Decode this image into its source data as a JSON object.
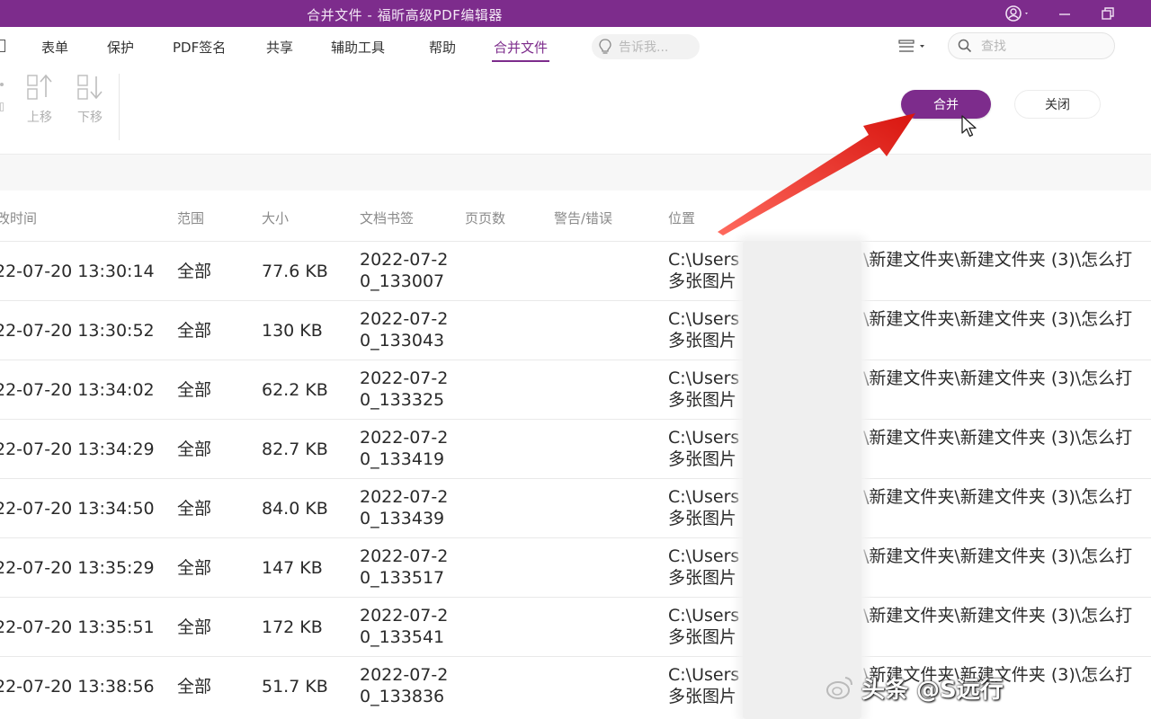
{
  "window": {
    "title": "合并文件 - 福昕高级PDF编辑器"
  },
  "menu": {
    "items": [
      "表单",
      "保护",
      "PDF签名",
      "共享",
      "辅助工具",
      "帮助",
      "合并文件"
    ],
    "active_index": 6,
    "tell_me_placeholder": "告诉我...",
    "search_placeholder": "查找"
  },
  "ribbon": {
    "move_up_label": "上移",
    "move_down_label": "下移",
    "merge_label": "合并",
    "close_label": "关闭"
  },
  "table": {
    "headers": {
      "modified": "改时间",
      "range": "范围",
      "size": "大小",
      "bookmark": "文档书签",
      "pages": "页页数",
      "warnings": "警告/错误",
      "location": "位置"
    },
    "rows": [
      {
        "time": "22-07-20 13:30:14",
        "range": "全部",
        "size": "77.6 KB",
        "bm1": "2022-07-2",
        "bm2": "0_133007",
        "loc1": "C:\\Users",
        "loc2": "多张图片",
        "path": "\\新建文件夹\\新建文件夹 (3)\\怎么打"
      },
      {
        "time": "22-07-20 13:30:52",
        "range": "全部",
        "size": "130 KB",
        "bm1": "2022-07-2",
        "bm2": "0_133043",
        "loc1": "C:\\Users",
        "loc2": "多张图片",
        "path": "\\新建文件夹\\新建文件夹 (3)\\怎么打"
      },
      {
        "time": "22-07-20 13:34:02",
        "range": "全部",
        "size": "62.2 KB",
        "bm1": "2022-07-2",
        "bm2": "0_133325",
        "loc1": "C:\\Users",
        "loc2": "多张图片",
        "path": "\\新建文件夹\\新建文件夹 (3)\\怎么打"
      },
      {
        "time": "22-07-20 13:34:29",
        "range": "全部",
        "size": "82.7 KB",
        "bm1": "2022-07-2",
        "bm2": "0_133419",
        "loc1": "C:\\Users",
        "loc2": "多张图片",
        "path": "\\新建文件夹\\新建文件夹 (3)\\怎么打"
      },
      {
        "time": "22-07-20 13:34:50",
        "range": "全部",
        "size": "84.0 KB",
        "bm1": "2022-07-2",
        "bm2": "0_133439",
        "loc1": "C:\\Users",
        "loc2": "多张图片",
        "path": "\\新建文件夹\\新建文件夹 (3)\\怎么打"
      },
      {
        "time": "22-07-20 13:35:29",
        "range": "全部",
        "size": "147 KB",
        "bm1": "2022-07-2",
        "bm2": "0_133517",
        "loc1": "C:\\Users",
        "loc2": "多张图片",
        "path": "\\新建文件夹\\新建文件夹 (3)\\怎么打"
      },
      {
        "time": "22-07-20 13:35:51",
        "range": "全部",
        "size": "172 KB",
        "bm1": "2022-07-2",
        "bm2": "0_133541",
        "loc1": "C:\\Users",
        "loc2": "多张图片",
        "path": "\\新建文件夹\\新建文件夹 (3)\\怎么打"
      },
      {
        "time": "22-07-20 13:38:56",
        "range": "全部",
        "size": "51.7 KB",
        "bm1": "2022-07-2",
        "bm2": "0_133836",
        "loc1": "C:\\Users",
        "loc2": "多张图片",
        "path": "\\新建文件夹\\新建文件夹 (3)\\怎么打"
      }
    ]
  },
  "watermark": {
    "text": "头条 @S远行"
  },
  "colors": {
    "brand": "#7d2c8c",
    "annotation_arrow": "#e8221f"
  },
  "icons": [
    "account-icon",
    "minimize-icon",
    "maximize-icon",
    "lightbulb-icon",
    "ribbon-options-icon",
    "search-icon",
    "move-up-icon",
    "move-down-icon",
    "cursor-icon"
  ]
}
